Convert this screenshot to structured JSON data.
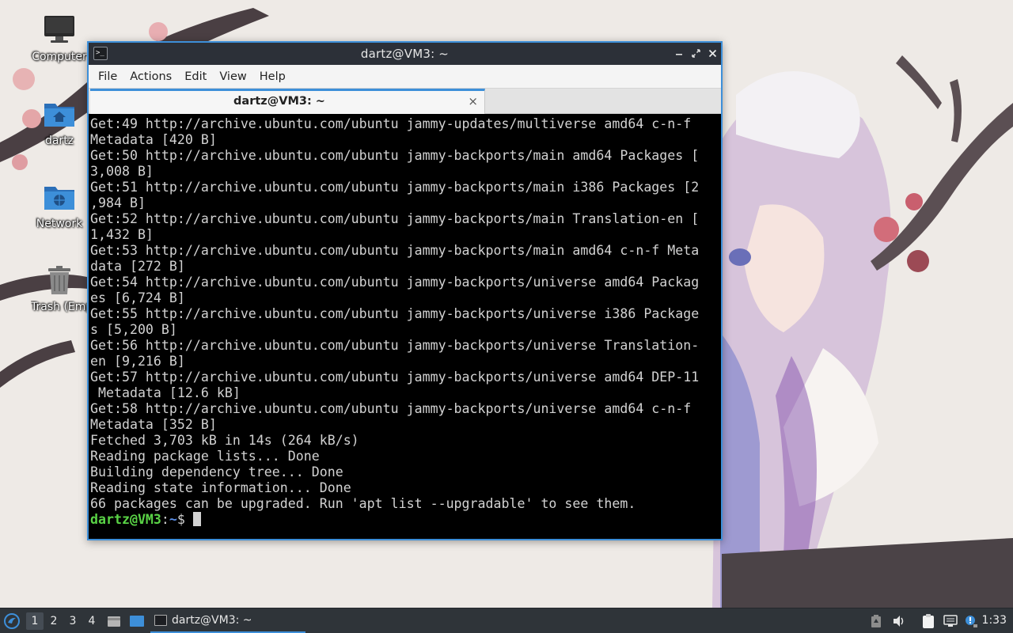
{
  "desktop": {
    "icons": [
      {
        "label": "Computer",
        "icon": "computer-icon"
      },
      {
        "label": "dartz",
        "icon": "home-folder-icon"
      },
      {
        "label": "Network",
        "icon": "network-folder-icon"
      },
      {
        "label": "Trash (Empty)",
        "icon": "trash-icon"
      }
    ]
  },
  "window": {
    "title": "dartz@VM3: ~",
    "menu": [
      "File",
      "Actions",
      "Edit",
      "View",
      "Help"
    ],
    "tab_label": "dartz@VM3: ~",
    "tab_close": "×",
    "controls": {
      "minimize": "–",
      "maximize": "⤢",
      "close": "✕"
    }
  },
  "terminal": {
    "lines": [
      "Get:49 http://archive.ubuntu.com/ubuntu jammy-updates/multiverse amd64 c-n-f",
      "Metadata [420 B]",
      "Get:50 http://archive.ubuntu.com/ubuntu jammy-backports/main amd64 Packages [",
      "3,008 B]",
      "Get:51 http://archive.ubuntu.com/ubuntu jammy-backports/main i386 Packages [2",
      ",984 B]",
      "Get:52 http://archive.ubuntu.com/ubuntu jammy-backports/main Translation-en [",
      "1,432 B]",
      "Get:53 http://archive.ubuntu.com/ubuntu jammy-backports/main amd64 c-n-f Meta",
      "data [272 B]",
      "Get:54 http://archive.ubuntu.com/ubuntu jammy-backports/universe amd64 Packag",
      "es [6,724 B]",
      "Get:55 http://archive.ubuntu.com/ubuntu jammy-backports/universe i386 Package",
      "s [5,200 B]",
      "Get:56 http://archive.ubuntu.com/ubuntu jammy-backports/universe Translation-",
      "en [9,216 B]",
      "Get:57 http://archive.ubuntu.com/ubuntu jammy-backports/universe amd64 DEP-11",
      " Metadata [12.6 kB]",
      "Get:58 http://archive.ubuntu.com/ubuntu jammy-backports/universe amd64 c-n-f",
      "Metadata [352 B]",
      "Fetched 3,703 kB in 14s (264 kB/s)",
      "Reading package lists... Done",
      "Building dependency tree... Done",
      "Reading state information... Done",
      "66 packages can be upgraded. Run 'apt list --upgradable' to see them."
    ],
    "prompt": {
      "user_host": "dartz@VM3",
      "colon": ":",
      "path": "~",
      "symbol": "$"
    },
    "colors": {
      "background": "#000000",
      "text": "#d2d2d2",
      "user": "#5ad446",
      "path": "#5b8fe8"
    }
  },
  "taskbar": {
    "workspaces": [
      "1",
      "2",
      "3",
      "4"
    ],
    "active_workspace": "1",
    "task_label": "dartz@VM3: ~",
    "clock": "1:33",
    "tray_icons": [
      "battery-icon",
      "volume-icon",
      "clipboard-icon",
      "network-icon",
      "notification-icon"
    ],
    "accent": "#3d8fd9"
  }
}
